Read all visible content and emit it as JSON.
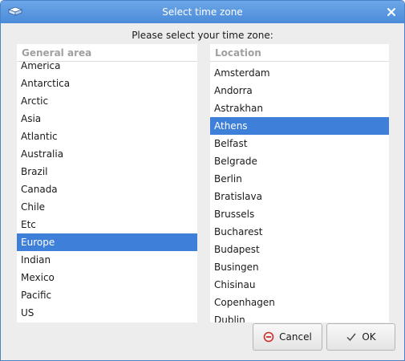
{
  "window": {
    "title": "Select time zone",
    "prompt": "Please select your time zone:"
  },
  "icons": {
    "app": "dialog-app-icon",
    "close": "close-icon",
    "cancel": "cancel-icon",
    "ok": "checkmark-icon"
  },
  "general_area": {
    "header": "General area",
    "items": [
      "America",
      "Antarctica",
      "Arctic",
      "Asia",
      "Atlantic",
      "Australia",
      "Brazil",
      "Canada",
      "Chile",
      "Etc",
      "Europe",
      "Indian",
      "Mexico",
      "Pacific",
      "US"
    ],
    "selected": "Europe"
  },
  "location": {
    "header": "Location",
    "items": [
      "Amsterdam",
      "Andorra",
      "Astrakhan",
      "Athens",
      "Belfast",
      "Belgrade",
      "Berlin",
      "Bratislava",
      "Brussels",
      "Bucharest",
      "Budapest",
      "Busingen",
      "Chisinau",
      "Copenhagen",
      "Dublin"
    ],
    "selected": "Athens"
  },
  "buttons": {
    "cancel": "Cancel",
    "ok": "OK"
  },
  "colors": {
    "titlebar": "#4a8bd9",
    "selection": "#3d7fd9"
  }
}
